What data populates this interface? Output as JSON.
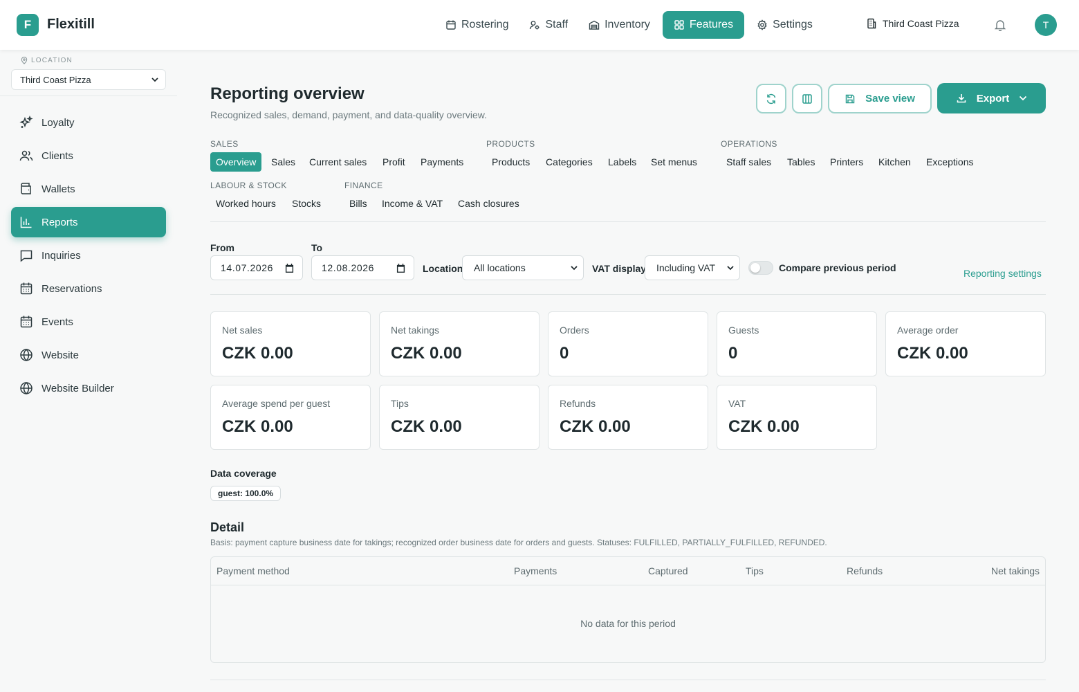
{
  "app": {
    "logo_letter": "F",
    "brand": "Flexitill",
    "avatar_letter": "T",
    "accent": "#2a9d8f"
  },
  "topnav": [
    {
      "label": "Rostering",
      "icon": "calendar-icon"
    },
    {
      "label": "Staff",
      "icon": "staff-icon"
    },
    {
      "label": "Inventory",
      "icon": "inventory-icon"
    },
    {
      "label": "Features",
      "icon": "grid-icon",
      "active": true
    },
    {
      "label": "Settings",
      "icon": "gear-icon"
    }
  ],
  "store_name": "Third Coast Pizza",
  "sidebar": {
    "location_label": "LOCATION",
    "location_value": "Third Coast Pizza",
    "items": [
      {
        "label": "Loyalty",
        "icon": "sparkles-icon"
      },
      {
        "label": "Clients",
        "icon": "users-icon"
      },
      {
        "label": "Wallets",
        "icon": "wallet-icon"
      },
      {
        "label": "Reports",
        "icon": "bar-chart-icon",
        "active": true
      },
      {
        "label": "Inquiries",
        "icon": "message-icon"
      },
      {
        "label": "Reservations",
        "icon": "calendar-icon"
      },
      {
        "label": "Events",
        "icon": "calendar-icon"
      },
      {
        "label": "Website",
        "icon": "globe-icon"
      },
      {
        "label": "Website Builder",
        "icon": "globe-icon"
      }
    ]
  },
  "page": {
    "title": "Reporting overview",
    "subtitle": "Recognized sales, demand, payment, and data-quality overview.",
    "save_view": "Save view",
    "export": "Export"
  },
  "tab_groups": {
    "sales": {
      "label": "SALES",
      "tabs": [
        "Overview",
        "Sales",
        "Current sales",
        "Profit",
        "Payments"
      ]
    },
    "products": {
      "label": "PRODUCTS",
      "tabs": [
        "Products",
        "Categories",
        "Labels",
        "Set menus"
      ]
    },
    "operations": {
      "label": "OPERATIONS",
      "tabs": [
        "Staff sales",
        "Tables",
        "Printers",
        "Kitchen",
        "Exceptions"
      ]
    },
    "labour": {
      "label": "LABOUR & STOCK",
      "tabs": [
        "Worked hours",
        "Stocks"
      ]
    },
    "finance": {
      "label": "FINANCE",
      "tabs": [
        "Bills",
        "Income & VAT",
        "Cash closures"
      ]
    }
  },
  "filters": {
    "from_label": "From",
    "from_value": "14.07.2026",
    "to_label": "To",
    "to_value": "12.08.2026",
    "location_label": "Location",
    "location_value": "All locations",
    "vat_label": "VAT display",
    "vat_value": "Including VAT",
    "compare_label": "Compare previous period",
    "compare_on": false,
    "settings_link": "Reporting settings"
  },
  "metrics": [
    {
      "label": "Net sales",
      "value": "CZK 0.00"
    },
    {
      "label": "Net takings",
      "value": "CZK 0.00"
    },
    {
      "label": "Orders",
      "value": "0"
    },
    {
      "label": "Guests",
      "value": "0"
    },
    {
      "label": "Average order",
      "value": "CZK 0.00"
    },
    {
      "label": "Average spend per guest",
      "value": "CZK 0.00"
    },
    {
      "label": "Tips",
      "value": "CZK 0.00"
    },
    {
      "label": "Refunds",
      "value": "CZK 0.00"
    },
    {
      "label": "VAT",
      "value": "CZK 0.00"
    }
  ],
  "coverage": {
    "title": "Data coverage",
    "chip": "guest: 100.0%"
  },
  "detail": {
    "title": "Detail",
    "basis": "Basis: payment capture business date for takings; recognized order business date for orders and guests. Statuses: FULFILLED, PARTIALLY_FULFILLED, REFUNDED.",
    "columns": [
      "Payment method",
      "Payments",
      "Captured",
      "Tips",
      "Refunds",
      "Net takings"
    ],
    "empty": "No data for this period"
  }
}
